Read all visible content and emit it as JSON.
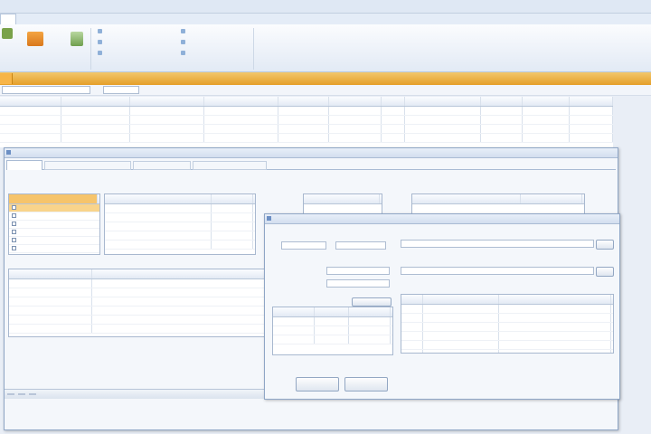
{
  "window": {
    "title": ""
  },
  "ribbon": {
    "home_tab": "",
    "small_buttons": [
      "",
      "",
      "",
      "",
      "",
      ""
    ],
    "group_labels": [
      "",
      ""
    ]
  },
  "toolbar": {
    "filter_value": "",
    "field_value": ""
  },
  "main_grid": {
    "columns": [
      "",
      "",
      "",
      "",
      "",
      "",
      "",
      "",
      "",
      "",
      ""
    ],
    "rows": [
      [
        "",
        "",
        "",
        "",
        "",
        "",
        "",
        "",
        "",
        "",
        ""
      ],
      [
        "",
        "",
        "",
        "",
        "",
        "",
        "",
        "",
        "",
        "",
        ""
      ],
      [
        "",
        "",
        "",
        "",
        "",
        "",
        "",
        "",
        "",
        "",
        ""
      ],
      [
        "",
        "",
        "",
        "",
        "",
        "",
        "",
        "",
        "",
        "",
        ""
      ]
    ]
  },
  "record_window": {
    "title": "",
    "tabs": [
      "",
      "",
      "",
      ""
    ],
    "panel_a": {
      "items": [
        "",
        "",
        "",
        "",
        "",
        ""
      ]
    },
    "panel_b": {
      "rows": [
        [
          "",
          ""
        ],
        [
          "",
          ""
        ],
        [
          "",
          ""
        ],
        [
          "",
          ""
        ],
        [
          "",
          ""
        ]
      ]
    },
    "lower_grid": {
      "columns": [
        "",
        ""
      ],
      "rows": [
        [
          "",
          ""
        ],
        [
          "",
          ""
        ],
        [
          "",
          ""
        ],
        [
          "",
          ""
        ],
        [
          "",
          ""
        ],
        [
          "",
          ""
        ]
      ]
    },
    "status": [
      "",
      "",
      ""
    ]
  },
  "dialog": {
    "title": "",
    "field1_label": "",
    "field1_values": [
      "",
      ""
    ],
    "section_label": "",
    "sub_label1": "",
    "sub_label2": "",
    "right_label1": "",
    "right_value1": "",
    "right_label2": "",
    "right_value2": "",
    "table_label": "",
    "mini_columns": [
      "",
      "",
      ""
    ],
    "mini_rows": [
      [
        "",
        "",
        ""
      ],
      [
        "",
        "",
        ""
      ],
      [
        "",
        "",
        ""
      ]
    ],
    "right_grid_columns": [
      "",
      ""
    ],
    "right_grid_rows": [
      [
        "",
        ""
      ],
      [
        "",
        ""
      ],
      [
        "",
        ""
      ],
      [
        "",
        ""
      ],
      [
        "",
        ""
      ],
      [
        "",
        ""
      ]
    ],
    "ok_button": "",
    "cancel_button": ""
  },
  "colors": {
    "accent": "#f0b041",
    "selection": "#f9d48b",
    "link": "#3b57a8",
    "frame": "#8fa6c6"
  }
}
